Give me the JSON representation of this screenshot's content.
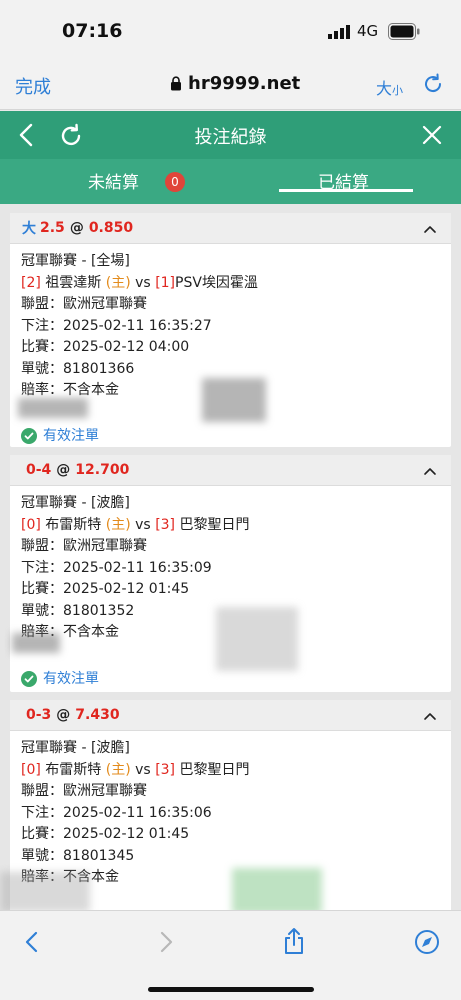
{
  "status": {
    "time": "07:16",
    "network": "4G"
  },
  "browser": {
    "done_label": "完成",
    "url": "hr9999.net",
    "text_size_label": "大",
    "text_size_small": "小"
  },
  "header": {
    "title": "投注紀錄"
  },
  "tabs": {
    "unsettled_label": "未結算",
    "unsettled_count": "0",
    "settled_label": "已結算"
  },
  "bets": [
    {
      "market_ou": "大",
      "line": "2.5",
      "at": "@",
      "odds": "0.850",
      "league_line": "冠軍聯賽 - [全場]",
      "home_score": "[2]",
      "home_team": "祖雲達斯",
      "home_tag": "(主)",
      "vs": "vs",
      "away_score": "[1]",
      "away_team": "PSV埃因霍溫",
      "league": "聯盟：歐洲冠軍聯賽",
      "placed": "下注：2025-02-11 16:35:27",
      "match": "比賽：2025-02-12 04:00",
      "ticket": "單號：81801366",
      "rate": "賠率：不含本金",
      "status": "有效注單"
    },
    {
      "market_ou": "",
      "line": "0-4",
      "at": "@",
      "odds": "12.700",
      "league_line": "冠軍聯賽 - [波膽]",
      "home_score": "[0]",
      "home_team": "布雷斯特",
      "home_tag": "(主)",
      "vs": "vs",
      "away_score": "[3]",
      "away_team": "巴黎聖日門",
      "league": "聯盟：歐洲冠軍聯賽",
      "placed": "下注：2025-02-11 16:35:09",
      "match": "比賽：2025-02-12 01:45",
      "ticket": "單號：81801352",
      "rate": "賠率：不含本金",
      "status": "有效注單"
    },
    {
      "market_ou": "",
      "line": "0-3",
      "at": "@",
      "odds": "7.430",
      "league_line": "冠軍聯賽 - [波膽]",
      "home_score": "[0]",
      "home_team": "布雷斯特",
      "home_tag": "(主)",
      "vs": "vs",
      "away_score": "[3]",
      "away_team": "巴黎聖日門",
      "league": "聯盟：歐洲冠軍聯賽",
      "placed": "下注：2025-02-11 16:35:06",
      "match": "比賽：2025-02-12 01:45",
      "ticket": "單號：81801345",
      "rate": "賠率：不含本金"
    }
  ],
  "colors": {
    "header_green": "#2f9e78",
    "tab_green": "#3aa983",
    "link_blue": "#2f7fd6",
    "odds_red": "#e0261f",
    "home_orange": "#e38b1c"
  }
}
